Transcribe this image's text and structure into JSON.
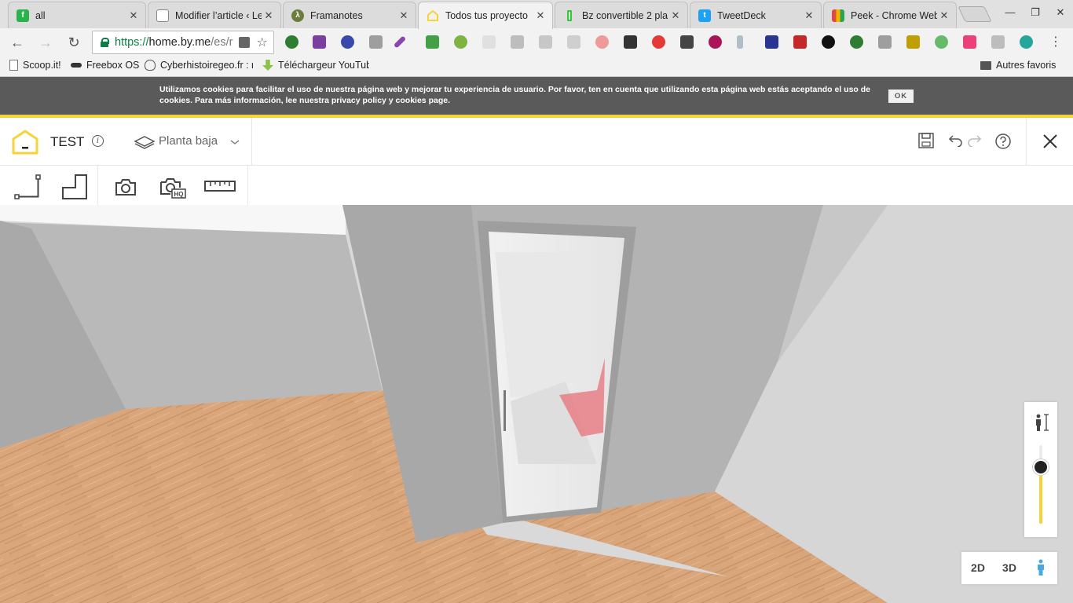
{
  "browser": {
    "tabs": [
      {
        "title": "all",
        "icon": "feedly-icon",
        "color": "#2bb24c",
        "active": false
      },
      {
        "title": "Modifier l’article ‹ Le",
        "icon": "document-icon",
        "color": "#888888",
        "active": false
      },
      {
        "title": "Framanotes",
        "icon": "framanotes-icon",
        "color": "#6a7d3a",
        "active": false
      },
      {
        "title": "Todos tus proyecto",
        "icon": "homebyme-icon",
        "color": "#f5d33a",
        "active": true
      },
      {
        "title": "Bz convertible 2 pla",
        "icon": "battery-icon",
        "color": "#33cc33",
        "active": false
      },
      {
        "title": "TweetDeck",
        "icon": "twitter-icon",
        "color": "#1da1f2",
        "active": false
      },
      {
        "title": "Peek - Chrome Web",
        "icon": "chrome-webstore-icon",
        "color": "#e04a3f",
        "active": false
      }
    ],
    "url": {
      "scheme": "https://",
      "host": "home.by.me",
      "path": "/es/r"
    },
    "bookmarks": [
      {
        "label": "Scoop.it!",
        "icon": "page-icon"
      },
      {
        "label": "Freebox OS",
        "icon": "freebox-icon"
      },
      {
        "label": "Cyberhistoiregeo.fr : r",
        "icon": "fox-icon"
      },
      {
        "label": "Téléchargeur YouTub",
        "icon": "download-icon"
      }
    ],
    "other_bookmarks": "Autres favoris"
  },
  "cookie": {
    "text": "Utilizamos cookies para facilitar el uso de nuestra página web y mejorar tu experiencia de usuario. Por favor, ten en cuenta que utilizando esta página web estás aceptando el uso de cookies. Para más información, lee nuestra privacy policy y cookies page.",
    "ok_label": "OK"
  },
  "app": {
    "project_title": "TEST",
    "info_symbol": "i",
    "floor": "Planta baja",
    "accent": "#f5d33a"
  },
  "viewmode": {
    "label_2d": "2D",
    "label_3d": "3D",
    "active": "person"
  },
  "camera_height": {
    "level": 0.72
  }
}
